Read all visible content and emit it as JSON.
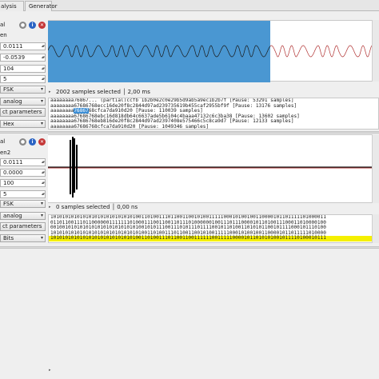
{
  "tabs": [
    "alysis",
    "Generator"
  ],
  "sig1": {
    "name_label": "al",
    "name_value": "en",
    "noise": "0.0111",
    "center": "-0.0539",
    "bit_length": "104",
    "tolerance": "5",
    "modulation": "FSK",
    "view_type": "analog",
    "detect_label": "ct parameters",
    "proto_format": "Hex",
    "status": "2002 samples selected  │  2,00 ms",
    "bit_lines": [
      {
        "pre": "aaaaaaaa",
        "sel": "",
        "post": "76867... (partial)ccfb 1b2b0e2c0e29b5d9ab5a9ec1b2b7f [Pause: 53291 samples]"
      },
      {
        "pre": "aaaaaaaa67686768ecc16de20f8c2844d97ad239735619b455caf2955bf9f ",
        "sel": "",
        "post": "[Pause: 13176 samples]"
      },
      {
        "pre": "aaaaaaaa",
        "sel": "76867",
        "post": "68cfca7da910d20 [Pause: 110039 samples]"
      },
      {
        "pre": "aaaaaaaa67686768ebc16d818db64c6637ade5b6104c4baaa47132c6c3ba38 ",
        "sel": "",
        "post": "[Pause: 13602 samples]"
      },
      {
        "pre": "aaaaaaaa67686768eb816de20f8c2844d97ad2397408e575466c5c8ca9d7 ",
        "sel": "",
        "post": "[Pause: 12133 samples]"
      },
      {
        "pre": "aaaaaaaa67686768cfca7da910d20 ",
        "sel": "",
        "post": "[Pause: 1049346 samples]"
      }
    ]
  },
  "sig2": {
    "name_label": "al",
    "name_value": "en2",
    "noise": "0.0111",
    "center": "0.0000",
    "bit_length": "100",
    "tolerance": "5",
    "modulation": "FSK",
    "view_type": "analog",
    "detect_label": "ct parameters",
    "proto_format": "Bits",
    "status": "0 samples selected  │  0,00 ns",
    "bit_lines": [
      "1010101010101010101010101010100110100111011001100101001111100010100100110000101101111101000011",
      "0110110011101100000011111110100011100110011011101000000100111011100001011010011100011010000100",
      "0010010101010101010101010101010010101110011101011101111001011010011010101100101111000101110100",
      "1010101010101010101010101010101001101001110110011001010011111000101001001100001011011111010000",
      "1010101010101010101010101010100110100111011001100111111001111100001011010101001011110100010111"
    ]
  },
  "colors": {
    "selection": "#4a97d2",
    "carrier": "#1a1a1a",
    "noise_line": "#b03030",
    "highlight": "#f5f000"
  }
}
